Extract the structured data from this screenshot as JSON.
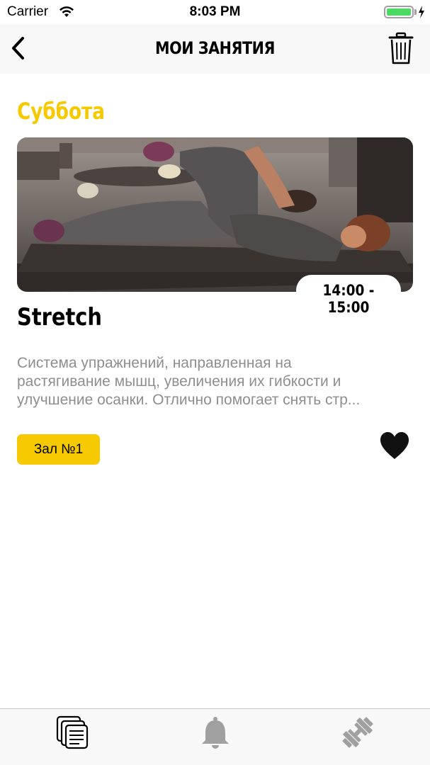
{
  "status_bar": {
    "carrier": "Carrier",
    "time": "8:03 PM",
    "battery_level": 1.0
  },
  "nav": {
    "title": "МОИ ЗАНЯТИЯ",
    "back_icon": "chevron-left-icon",
    "trash_icon": "trash-icon"
  },
  "schedule": {
    "day": "Суббота",
    "class": {
      "time_range": "14:00 - 15:00",
      "title": "Stretch",
      "description_lines": [
        "Система упражнений, направленная на",
        "растягивание мышц, увеличения их гибкости и",
        "улучшение осанки. Отлично помогает снять стр..."
      ],
      "hall": "Зал №1",
      "favorite": true
    }
  },
  "tab_bar": {
    "tabs": [
      {
        "icon": "document-list-icon",
        "active": true
      },
      {
        "icon": "bell-icon",
        "active": false
      },
      {
        "icon": "dumbbell-icon",
        "active": false
      }
    ]
  },
  "colors": {
    "accent": "#f7c900",
    "description_text": "#8e8e8e",
    "inactive_tab": "#a0a0a0"
  }
}
